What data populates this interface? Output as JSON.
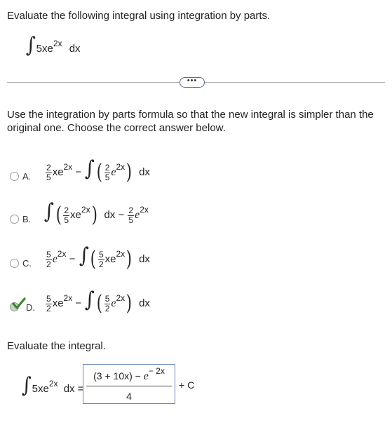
{
  "header": {
    "instruction": "Evaluate the following integral using integration by parts.",
    "integral": {
      "sign": "∫",
      "coef": "5xe",
      "exp": "2x",
      "dx": "dx"
    }
  },
  "more_button": {
    "label": "•••"
  },
  "question": {
    "text": "Use the integration by parts formula so that the new integral is simpler than the original one. Choose the correct answer below."
  },
  "options": [
    {
      "letter": "A.",
      "selected": false,
      "correct": false
    },
    {
      "letter": "B.",
      "selected": false,
      "correct": false
    },
    {
      "letter": "C.",
      "selected": false,
      "correct": false
    },
    {
      "letter": "D.",
      "selected": true,
      "correct": true
    }
  ],
  "math": {
    "two": "2",
    "five": "5",
    "xe": "xe",
    "e": "e",
    "exp": "2x",
    "minus": "−",
    "dx": "dx",
    "int": "∫"
  },
  "evaluate": {
    "text": "Evaluate the integral.",
    "lhs_coef": "5xe",
    "lhs_exp": "2x",
    "lhs_dx": "dx =",
    "answer_numerator_a": "(3 + 10x) − ",
    "answer_numerator_e": "e",
    "answer_numerator_exp": "− 2x",
    "answer_denominator": "4",
    "plus_c": "+ C"
  },
  "colors": {
    "check": "#3a8a2a",
    "box_border": "#6a88b8",
    "divider": "#b0b0b0"
  }
}
